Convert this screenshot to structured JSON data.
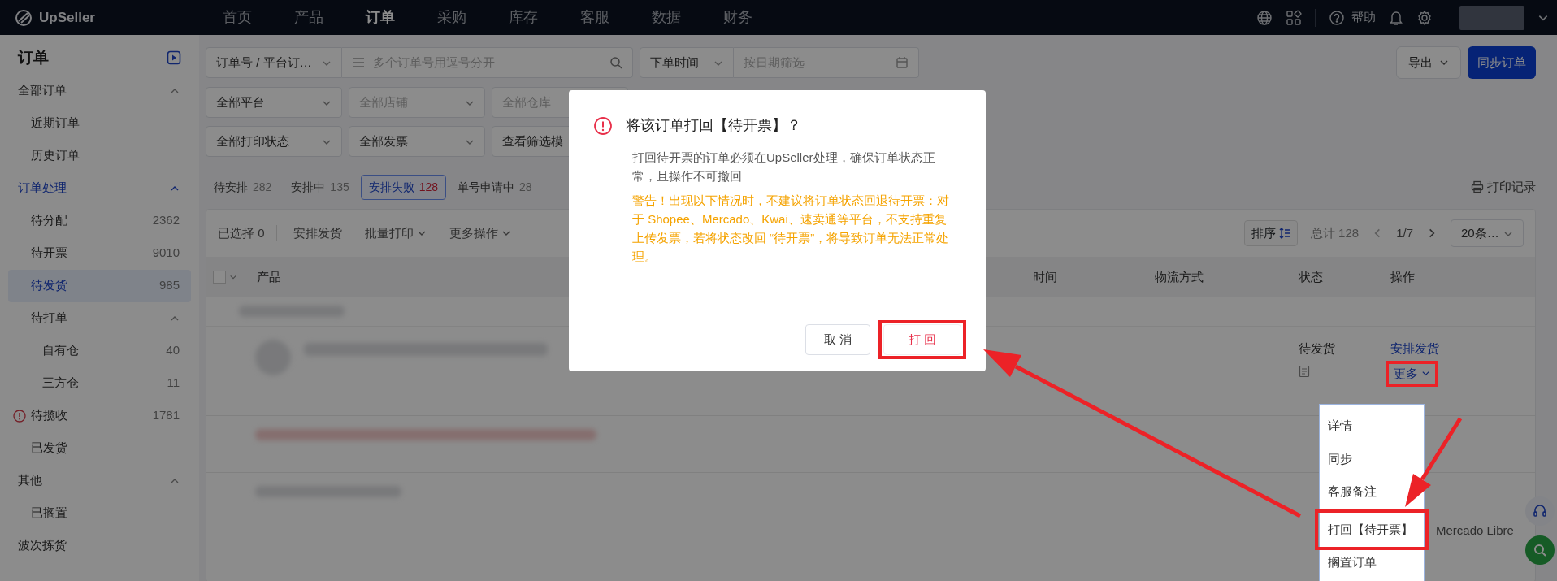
{
  "nav": {
    "logo": "UpSeller",
    "items": [
      {
        "label": "首页",
        "selected": false
      },
      {
        "label": "产品",
        "selected": false
      },
      {
        "label": "订单",
        "selected": true
      },
      {
        "label": "采购",
        "selected": false
      },
      {
        "label": "库存",
        "selected": false
      },
      {
        "label": "客服",
        "selected": false
      },
      {
        "label": "数据",
        "selected": false
      },
      {
        "label": "财务",
        "selected": false
      }
    ],
    "help": "帮助"
  },
  "sidebar": {
    "title": "订单",
    "items": [
      {
        "label": "全部订单",
        "selected": false,
        "expanded": true,
        "highlighted": false,
        "children": [
          {
            "label": "近期订单",
            "selected": false
          },
          {
            "label": "历史订单",
            "selected": false
          }
        ]
      },
      {
        "label": "订单处理",
        "selected": false,
        "expanded": true,
        "highlighted": true,
        "children": [
          {
            "label": "待分配",
            "count": "2362",
            "selected": false
          },
          {
            "label": "待开票",
            "count": "9010",
            "selected": false
          },
          {
            "label": "待发货",
            "count": "985",
            "selected": true
          },
          {
            "label": "待打单",
            "selected": false,
            "expanded": true,
            "highlighted": false,
            "children": [
              {
                "label": "自有仓",
                "count": "40",
                "selected": false
              },
              {
                "label": "三方仓",
                "count": "11",
                "selected": false
              }
            ]
          },
          {
            "label": "待揽收",
            "count": "1781",
            "selected": false,
            "alert": true
          },
          {
            "label": "已发货",
            "selected": false
          }
        ]
      },
      {
        "label": "其他",
        "selected": false,
        "expanded": true,
        "highlighted": false,
        "children": [
          {
            "label": "已搁置",
            "selected": false
          }
        ]
      },
      {
        "label": "波次拣货",
        "selected": false
      }
    ]
  },
  "filters": {
    "search": {
      "field": "订单号 / 平台订…",
      "placeholder": "多个订单号用逗号分开"
    },
    "date": {
      "field": "下单时间",
      "placeholder": "按日期筛选"
    },
    "export": "导出",
    "sync": "同步订单",
    "rows": [
      [
        {
          "kind": "select",
          "value": "全部平台"
        },
        {
          "kind": "select",
          "placeholder": "全部店铺"
        },
        {
          "kind": "select",
          "placeholder": "全部仓库"
        }
      ],
      [
        {
          "kind": "select",
          "value": "全部打印状态"
        },
        {
          "kind": "select",
          "value": "全部发票"
        },
        {
          "kind": "button",
          "value": "查看筛选模"
        }
      ]
    ]
  },
  "status_tabs": [
    {
      "label": "待安排",
      "count": "282",
      "selected": false
    },
    {
      "label": "安排中",
      "count": "135",
      "selected": false
    },
    {
      "label": "安排失败",
      "count": "128",
      "selected": true
    },
    {
      "label": "单号申请中",
      "count": "28",
      "selected": false
    }
  ],
  "print_log": "打印记录",
  "toolbar": {
    "selected_label": "已选择",
    "selected_count": "0",
    "actions": [
      {
        "label": "安排发货",
        "dropdown": false
      },
      {
        "label": "批量打印",
        "dropdown": true
      },
      {
        "label": "更多操作",
        "dropdown": true
      }
    ],
    "sort": "排序",
    "total": "总计 128",
    "page": "1/7",
    "page_size": "20条…"
  },
  "table": {
    "select_all": {
      "checked": false
    },
    "columns": [
      "产品",
      "时间",
      "物流方式",
      "状态",
      "操作"
    ],
    "row": {
      "status": "待发货",
      "primary_action": "安排发货",
      "more": {
        "label": "更多",
        "annotated": true
      }
    },
    "extra_text": "Mercado Libre"
  },
  "menu": [
    {
      "label": "详情",
      "annotated": false
    },
    {
      "label": "同步",
      "annotated": false
    },
    {
      "label": "客服备注",
      "annotated": false
    },
    {
      "label": "打回【待开票】",
      "annotated": true
    },
    {
      "label": "搁置订单",
      "annotated": false
    }
  ],
  "modal": {
    "title": "将该订单打回【待开票】？",
    "body": "打回待开票的订单必须在UpSeller处理，确保订单状态正常，且操作不可撤回",
    "warning": "警告！出现以下情况时，不建议将订单状态回退待开票：对于 Shopee、Mercado、Kwai、速卖通等平台，不支持重复上传发票，若将状态改回 “待开票”，将导致订单无法正常处理。",
    "buttons": [
      {
        "label": "取 消",
        "kind": "cancel",
        "annotated": false
      },
      {
        "label": "打 回",
        "kind": "confirm",
        "annotated": true
      }
    ]
  }
}
